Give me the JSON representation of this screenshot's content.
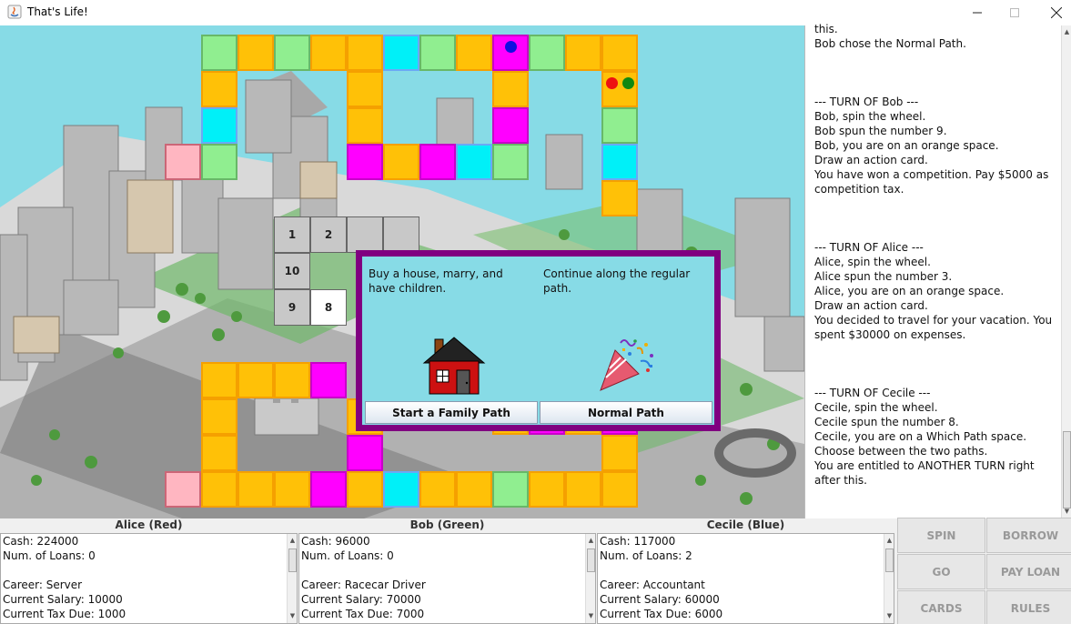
{
  "window": {
    "title": "That's Life!"
  },
  "board": {
    "cells": [
      {
        "c": "green"
      },
      {
        "c": "orange"
      },
      {
        "c": "green"
      },
      {
        "c": "orange"
      },
      {
        "c": "orange"
      },
      {
        "c": "cyan"
      },
      {
        "c": "green"
      },
      {
        "c": "orange"
      },
      {
        "c": "magenta"
      },
      {
        "c": "green"
      },
      {
        "c": "orange"
      },
      {
        "c": "orange"
      },
      {
        "c": "orange"
      },
      {
        "c": "orange"
      },
      {
        "c": "orange"
      },
      {
        "c": "orange"
      },
      {
        "c": "cyan"
      },
      {
        "c": "orange"
      },
      {
        "c": "magenta"
      },
      {
        "c": "green"
      },
      {
        "c": "pink"
      },
      {
        "c": "green"
      },
      {
        "c": "magenta"
      },
      {
        "c": "orange"
      },
      {
        "c": "magenta"
      },
      {
        "c": "cyan"
      },
      {
        "c": "green"
      },
      {
        "c": "cyan"
      },
      {
        "c": "orange"
      },
      {
        "c": "orange"
      },
      {
        "c": "orange"
      },
      {
        "c": "orange"
      },
      {
        "c": "magenta"
      },
      {
        "c": "orange"
      },
      {
        "c": "orange"
      },
      {
        "c": "magenta"
      },
      {
        "c": "orange"
      },
      {
        "c": "magenta"
      },
      {
        "c": "orange"
      },
      {
        "c": "magenta"
      },
      {
        "c": "orange"
      },
      {
        "c": "pink"
      },
      {
        "c": "orange"
      },
      {
        "c": "orange"
      },
      {
        "c": "orange"
      },
      {
        "c": "magenta"
      },
      {
        "c": "orange"
      },
      {
        "c": "cyan"
      },
      {
        "c": "orange"
      },
      {
        "c": "orange"
      },
      {
        "c": "green"
      },
      {
        "c": "orange"
      },
      {
        "c": "orange"
      },
      {
        "c": "orange"
      },
      {
        "c": "orange"
      }
    ],
    "numbers": [
      "1",
      "2",
      "10",
      "9",
      "8"
    ],
    "tokens": [
      {
        "player": "Cecile",
        "color": "#1010e0"
      },
      {
        "player": "Alice",
        "color": "#ee1111"
      },
      {
        "player": "Bob",
        "color": "#118811"
      }
    ]
  },
  "dialog": {
    "left_text": "Buy a house, marry, and have children.",
    "right_text": "Continue along the regular path.",
    "left_icon": "house-icon",
    "right_icon": "party-popper-icon",
    "left_button": "Start a Family Path",
    "right_button": "Normal Path"
  },
  "log": {
    "lines": "this.\nBob chose the Normal Path.\n\n\n\n--- TURN OF Bob ---\nBob, spin the wheel.\nBob spun the number 9.\nBob, you are on an orange space.\nDraw an action card.\nYou have won a competition. Pay $5000 as competition tax.\n\n\n\n--- TURN OF Alice ---\nAlice, spin the wheel.\nAlice spun the number 3.\nAlice, you are on an orange space.\nDraw an action card.\nYou decided to travel for your vacation. You spent $30000 on expenses.\n\n\n\n--- TURN OF Cecile ---\nCecile, spin the wheel.\nCecile spun the number 8.\nCecile, you are on a Which Path space.\nChoose between the two paths.\nYou are entitled to ANOTHER TURN right after this."
  },
  "players": [
    {
      "name": "Alice (Red)",
      "cash": "Cash: 224000",
      "loans": "Num. of Loans: 0",
      "career": "Career: Server",
      "salary": "Current Salary: 10000",
      "tax": "Current Tax Due: 1000"
    },
    {
      "name": "Bob (Green)",
      "cash": "Cash: 96000",
      "loans": "Num. of Loans: 0",
      "career": "Career: Racecar Driver",
      "salary": "Current Salary: 70000",
      "tax": "Current Tax Due: 7000"
    },
    {
      "name": "Cecile (Blue)",
      "cash": "Cash: 117000",
      "loans": "Num. of Loans: 2",
      "career": "Career: Accountant",
      "salary": "Current Salary: 60000",
      "tax": "Current Tax Due: 6000"
    }
  ],
  "controls": {
    "spin": "SPIN",
    "borrow": "BORROW",
    "go": "GO",
    "pay_loan": "PAY LOAN",
    "cards": "CARDS",
    "rules": "RULES"
  },
  "colors": {
    "orange": "#ffc107",
    "green": "#90ee90",
    "cyan": "#00f0f8",
    "magenta": "#ff00ff",
    "pink": "#ffb6c1",
    "dialog_border": "#800080",
    "sky": "#87dbe6"
  }
}
